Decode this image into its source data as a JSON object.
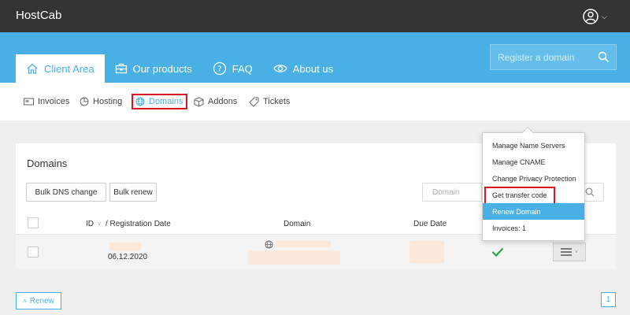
{
  "app": {
    "brand": "HostCab"
  },
  "header": {
    "tabs": [
      {
        "label": "Client Area",
        "icon": "home-icon",
        "active": true
      },
      {
        "label": "Our products",
        "icon": "briefcase-icon"
      },
      {
        "label": "FAQ",
        "icon": "question-icon"
      },
      {
        "label": "About us",
        "icon": "eye-icon"
      }
    ],
    "search_placeholder": "Register a domain"
  },
  "subnav": {
    "items": [
      {
        "label": "Invoices",
        "icon": "invoice-icon"
      },
      {
        "label": "Hosting",
        "icon": "pie-chart-icon"
      },
      {
        "label": "Domains",
        "icon": "globe-icon",
        "active": true
      },
      {
        "label": "Addons",
        "icon": "box-icon"
      },
      {
        "label": "Tickets",
        "icon": "tag-icon"
      }
    ]
  },
  "panel": {
    "title": "Domains",
    "buttons": {
      "bulk_dns": "Bulk DNS change",
      "bulk_renew": "Bulk renew"
    },
    "filter_placeholder": "Domain",
    "columns": {
      "id": "ID",
      "reg_date": "/ Registration Date",
      "domain": "Domain",
      "due_date": "Due Date"
    },
    "rows": [
      {
        "reg_date": "06.12.2020",
        "status": "active"
      }
    ]
  },
  "dropdown": {
    "items": [
      "Manage Name Servers",
      "Manage CNAME",
      "Change Privacy Protection",
      "Get transfer code",
      "Renew Domain",
      "Invoices: 1"
    ]
  },
  "footer": {
    "renew_label": "Renew",
    "page": "1"
  },
  "colors": {
    "accent": "#48b0e5",
    "topbar": "#343434",
    "highlight_box": "#d9161e",
    "check": "#27a745"
  }
}
